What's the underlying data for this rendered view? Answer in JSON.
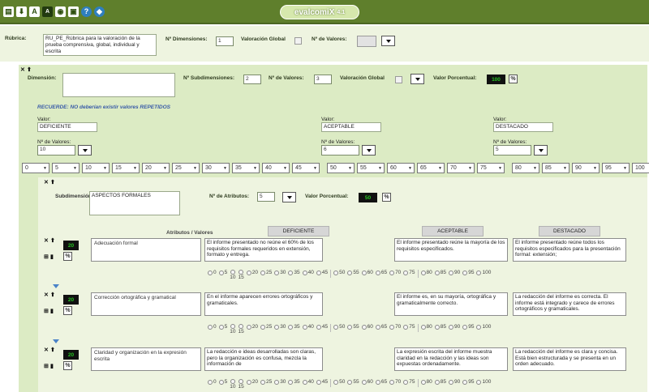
{
  "app": {
    "title": "evalcomiX",
    "version": "4.1",
    "toolbar_icons": [
      "save-icon",
      "download-icon",
      "font-large-icon",
      "font-small-icon",
      "view-icon",
      "print-icon",
      "help-icon",
      "shield-icon"
    ]
  },
  "rubric": {
    "label": "Rúbrica:",
    "value": "RU_PE_Rúbrica para la valoración de la prueba comprensiva, global, individual y escrita",
    "num_dimensions_label": "Nº Dimensiones:",
    "num_dimensions": "1",
    "global_label": "Valoración Global",
    "num_values_label": "Nº de Valores:"
  },
  "dimension": {
    "label": "Dimensión:",
    "value": "",
    "num_subdim_label": "Nº Subdimensiones:",
    "num_subdim": "2",
    "num_values_label": "Nº de Valores:",
    "num_values": "3",
    "global_label": "Valoración Global",
    "pct_label": "Valor Porcentual:",
    "pct_value": "100",
    "warning": "RECUERDE: NO deberían existir valores REPETIDOS",
    "value_label": "Valor:",
    "num_values_short": "Nº de Valores:",
    "values": [
      {
        "name": "DEFICIENTE",
        "count": "10"
      },
      {
        "name": "ACEPTABLE",
        "count": "6"
      },
      {
        "name": "DESTACADO",
        "count": "5"
      }
    ],
    "scale": [
      "0",
      "5",
      "10",
      "15",
      "20",
      "25",
      "30",
      "35",
      "40",
      "45",
      "50",
      "55",
      "60",
      "65",
      "70",
      "75",
      "80",
      "85",
      "90",
      "95",
      "100"
    ]
  },
  "subdimension": {
    "label": "Subdimensión:",
    "value": "ASPECTOS FORMALES",
    "num_attr_label": "Nº de Atributos:",
    "num_attr": "5",
    "pct_label": "Valor Porcentual:",
    "pct_value": "50",
    "col_header_attrs": "Atributos / Valores",
    "col_headers": [
      "DEFICIENTE",
      "ACEPTABLE",
      "DESTACADO"
    ],
    "radio_values": [
      "0",
      "5",
      "10",
      "15",
      "20",
      "25",
      "30",
      "35",
      "40",
      "45",
      "50",
      "55",
      "60",
      "65",
      "70",
      "75",
      "80",
      "85",
      "90",
      "95",
      "100"
    ],
    "attributes": [
      {
        "weight": "20",
        "name": "Adecuación formal",
        "deficiente": "El informe presentado no reúne el 60% de los requisitos formales requeridos en extensión, formato y entrega.",
        "aceptable": "El informe presentado reúne la mayoría de los requisitos especificados.",
        "destacado": "El informe presentado reúne todos los requisitos especificados para la presentación formal: extensión;"
      },
      {
        "weight": "20",
        "name": "Corrección ortográfica y gramatical",
        "deficiente": "En el informe aparecen errores ortográficos y gramaticales.",
        "aceptable": "El informe es, en su mayoría, ortográfica y gramaticalmente correcto.",
        "destacado": "La redacción del informe es correcta. El informe está integrado y carece de errores ortográficos y gramaticales."
      },
      {
        "weight": "20",
        "name": "Claridad y organización en la expresión escrita",
        "deficiente": "La redacción e ideas desarrolladas son claras, pero la organización es confusa, mezcla la información de",
        "aceptable": "La expresión escrita del informe muestra claridad en la redacción y las ideas son expuestas ordenadamente.",
        "destacado": "La redacción del informe es clara y concisa. Está bien estructurada y se presenta en un orden adecuado."
      }
    ]
  },
  "colors": {
    "titlebar": "#5f7f2c",
    "panel_green": "#dcebc4",
    "panel_light": "#eef4e0",
    "weight_text": "#26c522",
    "warning_text": "#3a5ca8"
  }
}
